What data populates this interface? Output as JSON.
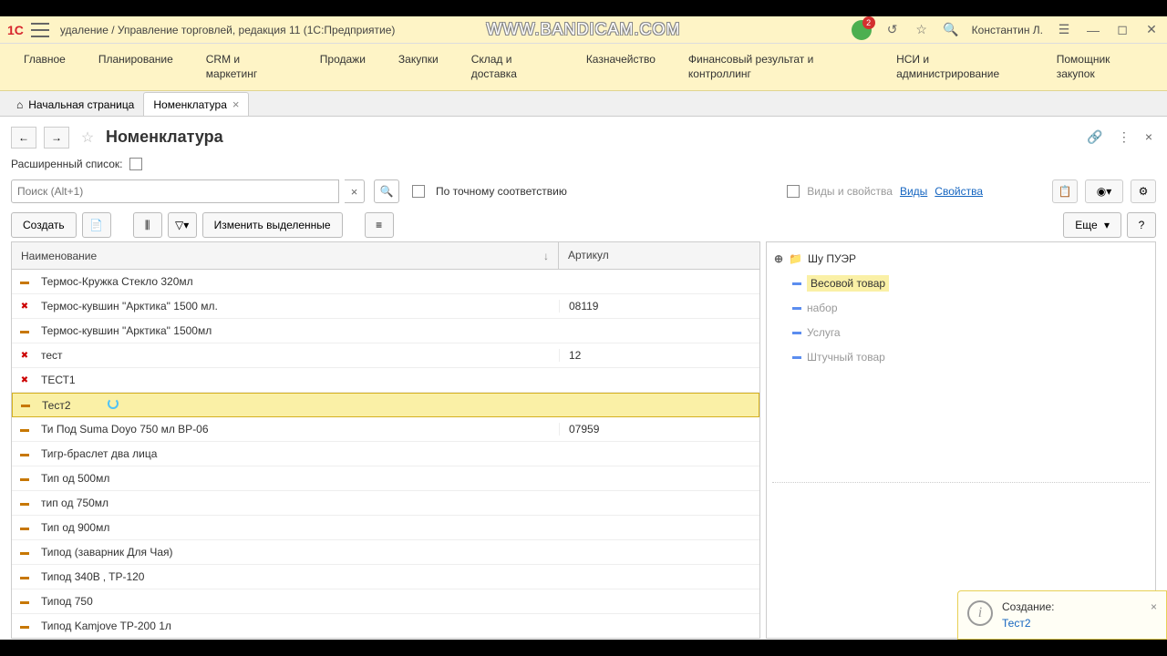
{
  "titlebar": {
    "title": "удаление / Управление торговлей, редакция 11  (1С:Предприятие)",
    "watermark": "WWW.BANDICAM.COM",
    "badge": "2",
    "username": "Константин Л."
  },
  "menu": [
    "Главное",
    "Планирование",
    "CRM и маркетинг",
    "Продажи",
    "Закупки",
    "Склад и доставка",
    "Казначейство",
    "Финансовый результат и контроллинг",
    "НСИ и администрирование",
    "Помощник закупок"
  ],
  "tabs": {
    "home": "Начальная страница",
    "active": "Номенклатура"
  },
  "page": {
    "title": "Номенклатура",
    "ext_label": "Расширенный список:",
    "search_placeholder": "Поиск (Alt+1)",
    "exact": "По точному соответствию"
  },
  "rightheader": {
    "label": "Виды и свойства",
    "link1": "Виды",
    "link2": "Свойства"
  },
  "toolbar": {
    "create": "Создать",
    "edit": "Изменить выделенные",
    "more": "Еще",
    "help": "?"
  },
  "columns": {
    "name": "Наименование",
    "sort": "↓",
    "art": "Артикул"
  },
  "rows": [
    {
      "icon": "minus",
      "name": "Термос-Кружка Стекло 320мл",
      "art": ""
    },
    {
      "icon": "del",
      "name": "Термос-кувшин \"Арктика\" 1500 мл.",
      "art": "08119"
    },
    {
      "icon": "minus",
      "name": "Термос-кувшин \"Арктика\" 1500мл",
      "art": ""
    },
    {
      "icon": "del",
      "name": "тест",
      "art": "12"
    },
    {
      "icon": "del",
      "name": "ТЕСТ1",
      "art": ""
    },
    {
      "icon": "minus",
      "name": "Тест2",
      "art": "",
      "selected": true,
      "loading": true
    },
    {
      "icon": "minus",
      "name": "Ти Под Suma Doyo 750 мл BP-06",
      "art": "07959"
    },
    {
      "icon": "minus",
      "name": "Тигр-браслет два лица",
      "art": ""
    },
    {
      "icon": "minus",
      "name": "Тип од 500мл",
      "art": ""
    },
    {
      "icon": "minus",
      "name": "тип од 750мл",
      "art": ""
    },
    {
      "icon": "minus",
      "name": "Тип од 900мл",
      "art": ""
    },
    {
      "icon": "minus",
      "name": "Типод (заварник Для Чая)",
      "art": ""
    },
    {
      "icon": "minus",
      "name": "Типод 340В ‚ ТР-120",
      "art": ""
    },
    {
      "icon": "minus",
      "name": "Типод 750",
      "art": ""
    },
    {
      "icon": "minus",
      "name": "Типод Kamjove TP-200  1л",
      "art": ""
    }
  ],
  "tree": [
    {
      "type": "folder",
      "text": "Шу ПУЭР",
      "expand": true
    },
    {
      "type": "item",
      "text": "Весовой товар",
      "selected": true
    },
    {
      "type": "item",
      "text": "набор",
      "gray": true
    },
    {
      "type": "item",
      "text": "Услуга",
      "gray": true
    },
    {
      "type": "item",
      "text": "Штучный товар",
      "gray": true
    }
  ],
  "notif": {
    "title": "Создание:",
    "link": "Тест2"
  }
}
